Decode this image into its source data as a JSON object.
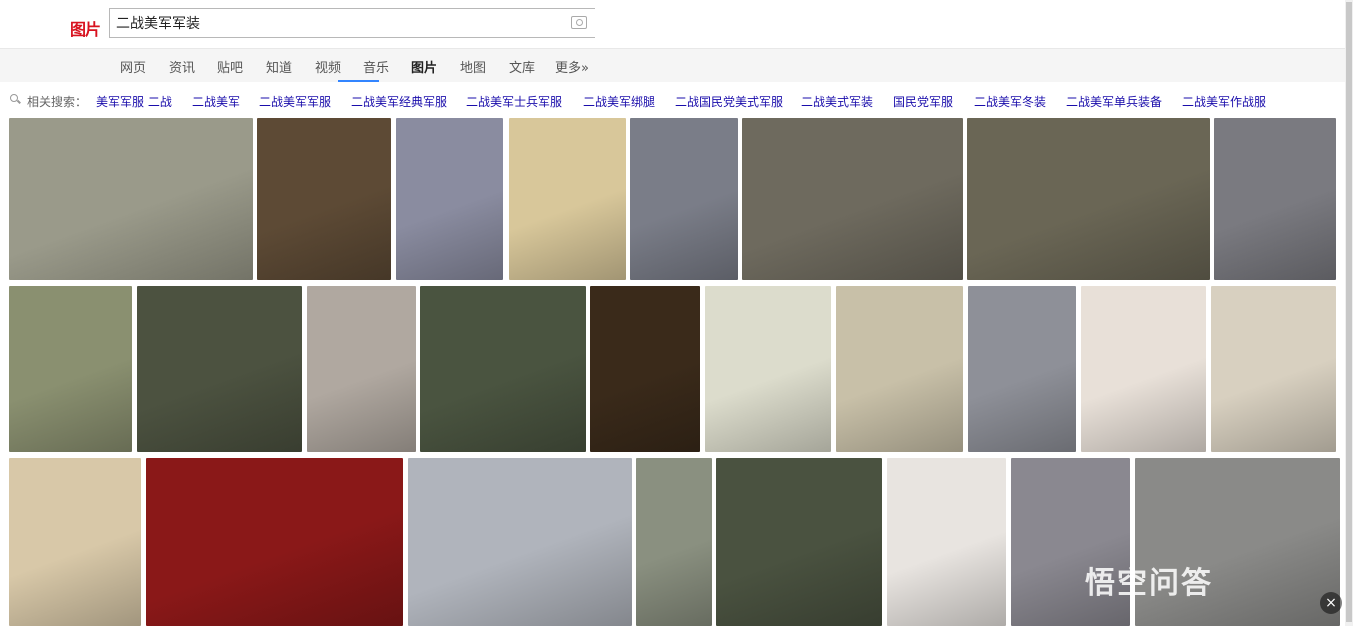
{
  "header": {
    "logo": "图片",
    "query": "二战美军军装"
  },
  "nav": {
    "items": [
      "网页",
      "资讯",
      "贴吧",
      "知道",
      "视频",
      "音乐",
      "图片",
      "地图",
      "文库",
      "更多»"
    ],
    "active": 6
  },
  "related": {
    "label": "相关搜索：",
    "items": [
      "美军军服 二战",
      "二战美军",
      "二战美军军服",
      "二战美军经典军服",
      "二战美军士兵军服",
      "二战美军绑腿",
      "二战国民党美式军服",
      "二战美式军装",
      "国民党军服",
      "二战美军冬装",
      "二战美军单兵装备",
      "二战美军作战服"
    ]
  },
  "images": {
    "colors": [
      [
        "#9a9a8a",
        "#5d4a35",
        "#8a8ca0",
        "#d8c79a",
        "#7a7d88",
        "#6e6a5e",
        "#6a6655",
        "#7a7a80"
      ],
      [
        "#8a9070",
        "#4c5240",
        "#b0a8a0",
        "#4a5440",
        "#3a2a1a",
        "#dcdccc",
        "#c8c0a8",
        "#8e9098",
        "#e8e0d8",
        "#d8d0c0"
      ],
      [
        "#d8c8a8",
        "#8a1818",
        "#b0b4bc",
        "#8a9080",
        "#4a5240",
        "#e8e4e0",
        "#8a8890",
        "#8a8a88"
      ]
    ]
  },
  "watermark": "悟空问答"
}
